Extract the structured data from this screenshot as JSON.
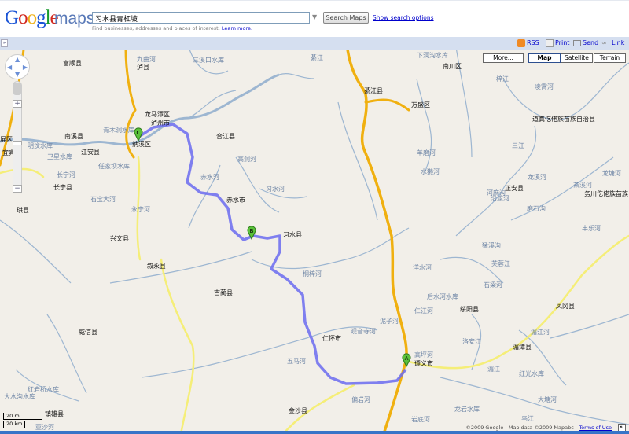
{
  "header": {
    "logo": "Google",
    "logo_maps": "maps",
    "search_value": "习水县青杠坡",
    "search_button": "Search Maps",
    "show_options": "Show search options",
    "hint": "Find businesses, addresses and places of interest.",
    "learn_more": "Learn more."
  },
  "toolbar": {
    "collapse": "»",
    "rss": "RSS",
    "print": "Print",
    "send": "Send",
    "link": "Link"
  },
  "map_types": {
    "more": "More...",
    "map": "Map",
    "satellite": "Satellite",
    "terrain": "Terrain",
    "selected": "Map"
  },
  "markers": {
    "a": "A",
    "b": "B",
    "c": "C"
  },
  "scale": {
    "mi": "20 mi",
    "km": "20 km"
  },
  "copyright": {
    "text": "©2009 Google - Map data ©2009 Mapabc - ",
    "terms": "Terms of Use"
  },
  "colors": {
    "route": "#6b6bf0",
    "highway": "#f0b010",
    "road": "#f5ee78",
    "water": "#9db6d1",
    "land": "#f2efe9"
  },
  "map": {
    "labels": [
      "富顺县",
      "九曲河",
      "泸县",
      "三溪口水库",
      "龙马潭区",
      "泸州市",
      "青木洞水库",
      "纳溪区",
      "南溪县",
      "江安县",
      "明汶水库",
      "卫星水库",
      "任家坝水库",
      "长宁河",
      "长宁县",
      "石宝大河",
      "永宁河",
      "珙县",
      "合江县",
      "赤水河",
      "赤水市",
      "习水河",
      "高洞河",
      "綦江",
      "綦江县",
      "万盛区",
      "下洞沟水库",
      "南川区",
      "羊磨河",
      "水獭河",
      "河麻沟",
      "梓江",
      "凌霄河",
      "道真仡佬族苗族自治县",
      "三江",
      "龙溪河",
      "正安县",
      "沿渡河",
      "磨石沟",
      "茶溪河",
      "龙塘河",
      "务川仡佬族苗族自治县",
      "丰乐河",
      "习水县",
      "叙永县",
      "桐梓河",
      "古蔺县",
      "观音寺河",
      "仁怀市",
      "五马河",
      "泥子河",
      "洋水河",
      "后水河水库",
      "仁江河",
      "绥阳县",
      "芙蓉江",
      "石梁河",
      "猛溪沟",
      "凤冈县",
      "洛安江",
      "湄江河",
      "湄潭县",
      "湄江",
      "红光水库",
      "高坪河",
      "遵义市",
      "威信县",
      "红岩桥水库",
      "大水沟水库",
      "镇雄县",
      "金沙县",
      "偏岩河",
      "岩底河",
      "龙岩水库",
      "大塘河",
      "乌江",
      "亚沙河",
      "兴文县",
      "屏区",
      "宜宾"
    ]
  }
}
